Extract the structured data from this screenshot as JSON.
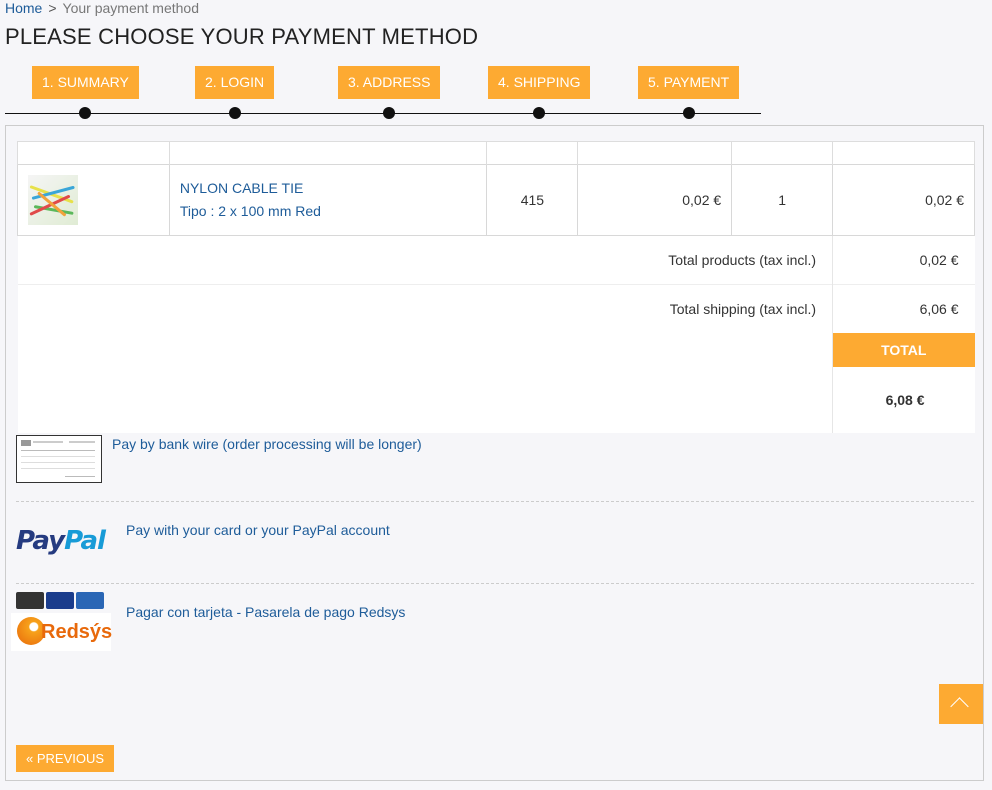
{
  "breadcrumb": {
    "home": "Home",
    "separator": ">",
    "current": "Your payment method"
  },
  "page_title": "PLEASE CHOOSE YOUR PAYMENT METHOD",
  "steps": [
    "1. SUMMARY",
    "2. LOGIN",
    "3. ADDRESS",
    "4. SHIPPING",
    "5. PAYMENT"
  ],
  "cart": {
    "item": {
      "name": "NYLON CABLE TIE",
      "variant": "Tipo : 2 x 100 mm Red",
      "reference": "415",
      "unit_price": "0,02 €",
      "quantity": "1",
      "total": "0,02 €"
    },
    "total_products_label": "Total products (tax incl.)",
    "total_products_value": "0,02 €",
    "total_shipping_label": "Total shipping (tax incl.)",
    "total_shipping_value": "6,06 €",
    "total_label": "TOTAL",
    "total_value": "6,08 €"
  },
  "payment_options": {
    "bankwire": "Pay by bank wire (order processing will be longer)",
    "paypal": "Pay with your card or your PayPal account",
    "paypal_logo_a": "Pay",
    "paypal_logo_b": "Pal",
    "redsys": "Pagar con tarjeta - Pasarela de pago Redsys",
    "redsys_logo": "Redsýs"
  },
  "previous_button": "« PREVIOUS",
  "colors": {
    "accent": "#fdaa32",
    "link": "#1e5c99"
  },
  "icons": {
    "scroll_top": "chevron-up-icon"
  }
}
